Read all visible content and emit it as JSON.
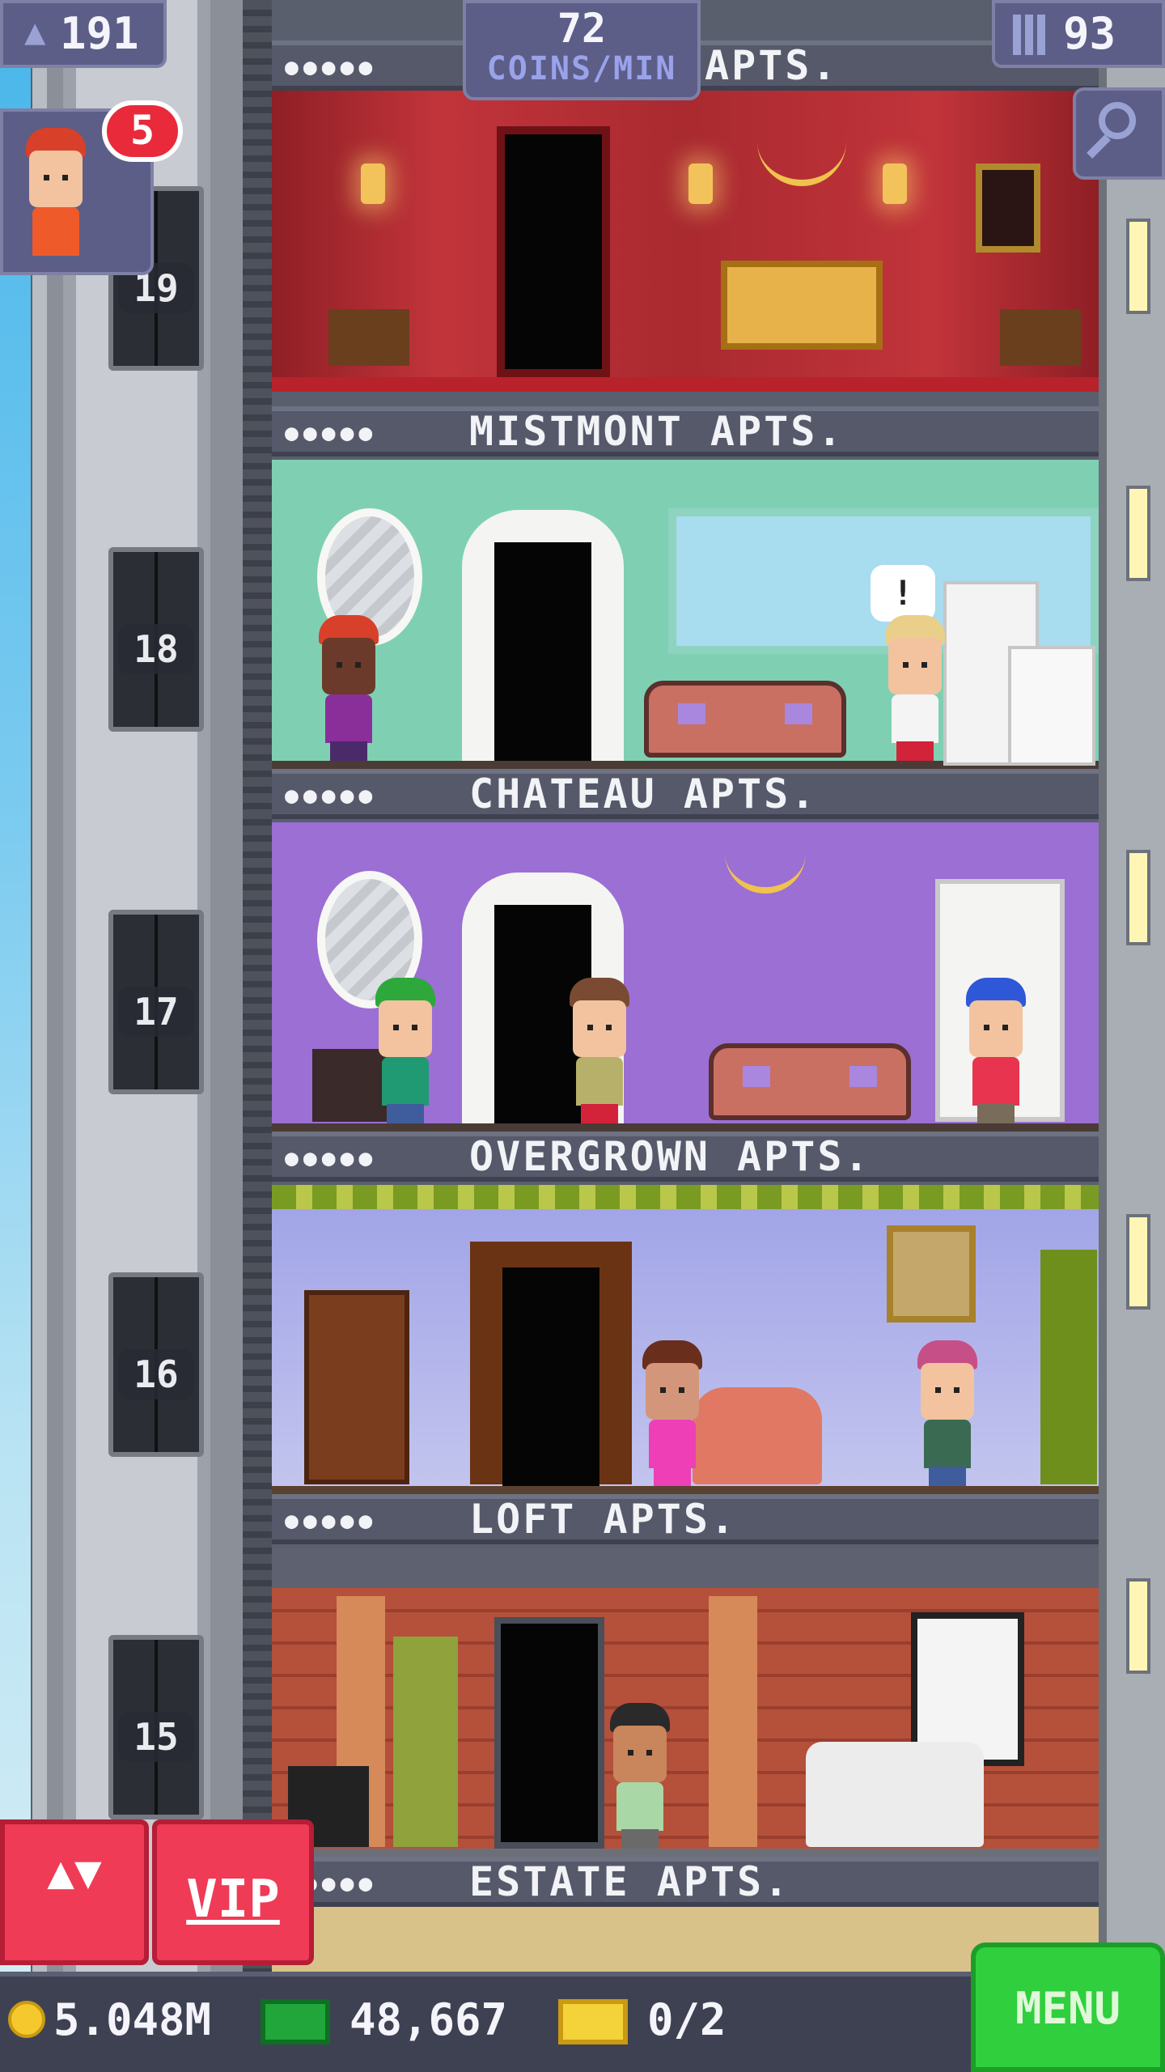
{
  "hud": {
    "population": "191",
    "coins_rate_value": "72",
    "coins_rate_label": "COINS/MIN",
    "floor_count": "93",
    "notification_badge": "5"
  },
  "floors": [
    {
      "name": "APTS.",
      "floor_number": "19"
    },
    {
      "name": "MISTMONT APTS.",
      "floor_number": "18"
    },
    {
      "name": "CHATEAU APTS.",
      "floor_number": "17"
    },
    {
      "name": "OVERGROWN APTS.",
      "floor_number": "16"
    },
    {
      "name": "LOFT APTS.",
      "floor_number": "15"
    },
    {
      "name": "ESTATE APTS."
    }
  ],
  "resident_dots": "●●●●●",
  "speech_bubble": "!",
  "buttons": {
    "elevator": "▲▼",
    "vip": "VIP",
    "menu": "MENU"
  },
  "bottom_bar": {
    "coins": "5.048M",
    "bux": "48,667",
    "tickets": "0/2"
  },
  "colors": {
    "hud_bg": "#5c5e88",
    "vip_red": "#ef3b55",
    "menu_green": "#2fcf3d"
  }
}
